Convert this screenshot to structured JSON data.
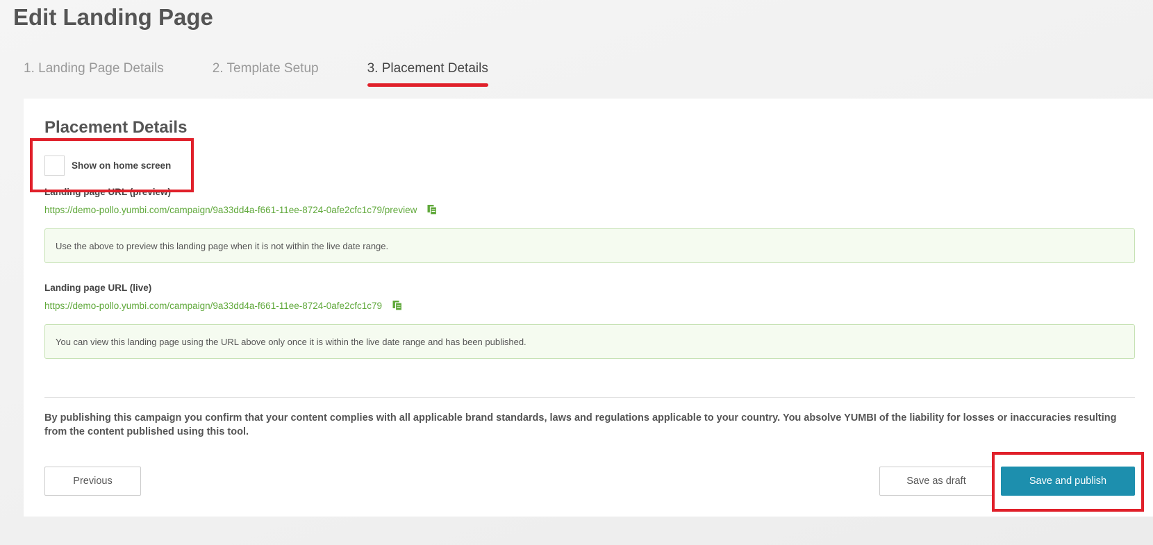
{
  "page": {
    "title": "Edit Landing Page"
  },
  "steps": [
    {
      "label": "1. Landing Page Details",
      "active": false
    },
    {
      "label": "2. Template Setup",
      "active": false
    },
    {
      "label": "3. Placement Details",
      "active": true
    }
  ],
  "section": {
    "title": "Placement Details"
  },
  "home_screen": {
    "label": "Show on home screen",
    "checked": false
  },
  "preview": {
    "label": "Landing page URL (preview)",
    "url": "https://demo-pollo.yumbi.com/campaign/9a33dd4a-f661-11ee-8724-0afe2cfc1c79/preview",
    "info": "Use the above to preview this landing page when it is not within the live date range."
  },
  "live": {
    "label": "Landing page URL (live)",
    "url": "https://demo-pollo.yumbi.com/campaign/9a33dd4a-f661-11ee-8724-0afe2cfc1c79",
    "info": "You can view this landing page using the URL above only once it is within the live date range and has been published."
  },
  "disclaimer": "By publishing this campaign you confirm that your content complies with all applicable brand standards, laws and regulations applicable to your country. You absolve YUMBI of the liability for losses or inaccuracies resulting from the content published using this tool.",
  "buttons": {
    "previous": "Previous",
    "save_draft": "Save as draft",
    "save_publish": "Save and publish"
  },
  "colors": {
    "accent": "#1d8fae",
    "link": "#5fa83a",
    "highlight": "#e0202a",
    "info_bg": "#f5fbf0"
  },
  "icons": {
    "copy": "copy-icon"
  }
}
